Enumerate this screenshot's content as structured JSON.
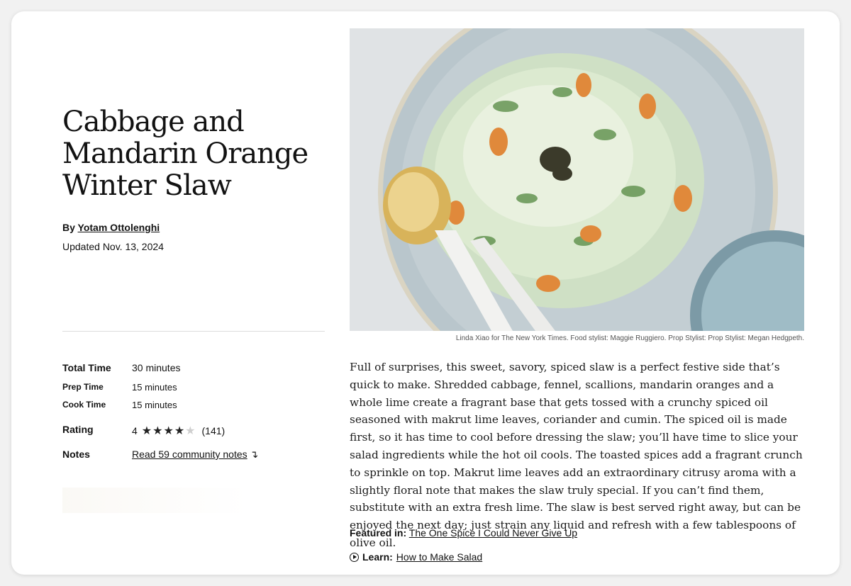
{
  "recipe": {
    "title": "Cabbage and Mandarin Orange Winter Slaw",
    "byline_prefix": "By",
    "author": "Yotam Ottolenghi",
    "updated": "Updated Nov. 13, 2024"
  },
  "meta": {
    "total_time_label": "Total Time",
    "total_time_value": "30 minutes",
    "prep_time_label": "Prep Time",
    "prep_time_value": "15 minutes",
    "cook_time_label": "Cook Time",
    "cook_time_value": "15 minutes",
    "rating_label": "Rating",
    "rating_value": "4",
    "rating_stars_filled": 4,
    "rating_stars_total": 5,
    "rating_count": "(141)",
    "notes_label": "Notes",
    "notes_link": "Read 59 community notes",
    "notes_arrow": "↴"
  },
  "photo": {
    "credit": "Linda Xiao for The New York Times. Food stylist: Maggie Ruggiero. Prop Stylist: Prop Stylist: Megan Hedgpeth."
  },
  "description": "Full of surprises, this sweet, savory, spiced slaw is a perfect festive side that’s quick to make. Shredded cabbage, fennel, scallions, mandarin oranges and a whole lime create a fragrant base that gets tossed with a crunchy spiced oil seasoned with makrut lime leaves, coriander and cumin. The spiced oil is made first, so it has time to cool before dressing the slaw; you’ll have time to slice your salad ingredients while the hot oil cools. The toasted spices add a fragrant crunch to sprinkle on top. Makrut lime leaves add an extraordinary citrusy aroma with a slightly floral note that makes the slaw truly special. If you can’t find them, substitute with an extra fresh lime. The slaw is best served right away, but can be enjoyed the next day; just strain any liquid and refresh with a few tablespoons of olive oil.",
  "featured": {
    "label": "Featured in:",
    "link": "The One Spice I Could Never Give Up"
  },
  "learn": {
    "icon": "play-circle-icon",
    "label": "Learn:",
    "link": "How to Make Salad"
  }
}
